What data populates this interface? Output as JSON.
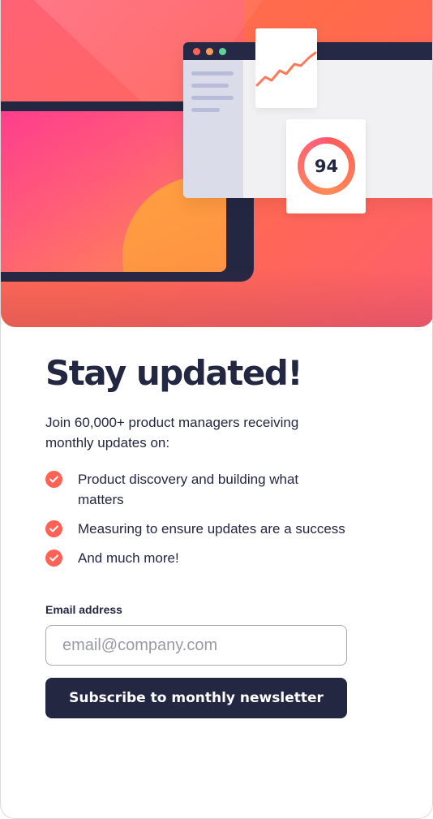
{
  "hero": {
    "score_value": "94",
    "colors": {
      "primary": "#ff6155",
      "dark": "#242742"
    }
  },
  "newsletter": {
    "title": "Stay updated!",
    "intro": "Join 60,000+ product managers receiving monthly updates on:",
    "features": [
      {
        "label": "Product discovery and building what matters",
        "icon": "check-icon"
      },
      {
        "label": "Measuring to ensure updates are a success",
        "icon": "check-icon"
      },
      {
        "label": "And much more!",
        "icon": "check-icon"
      }
    ],
    "email_label": "Email address",
    "email_placeholder": "email@company.com",
    "email_value": "",
    "submit_label": "Subscribe to monthly newsletter"
  }
}
